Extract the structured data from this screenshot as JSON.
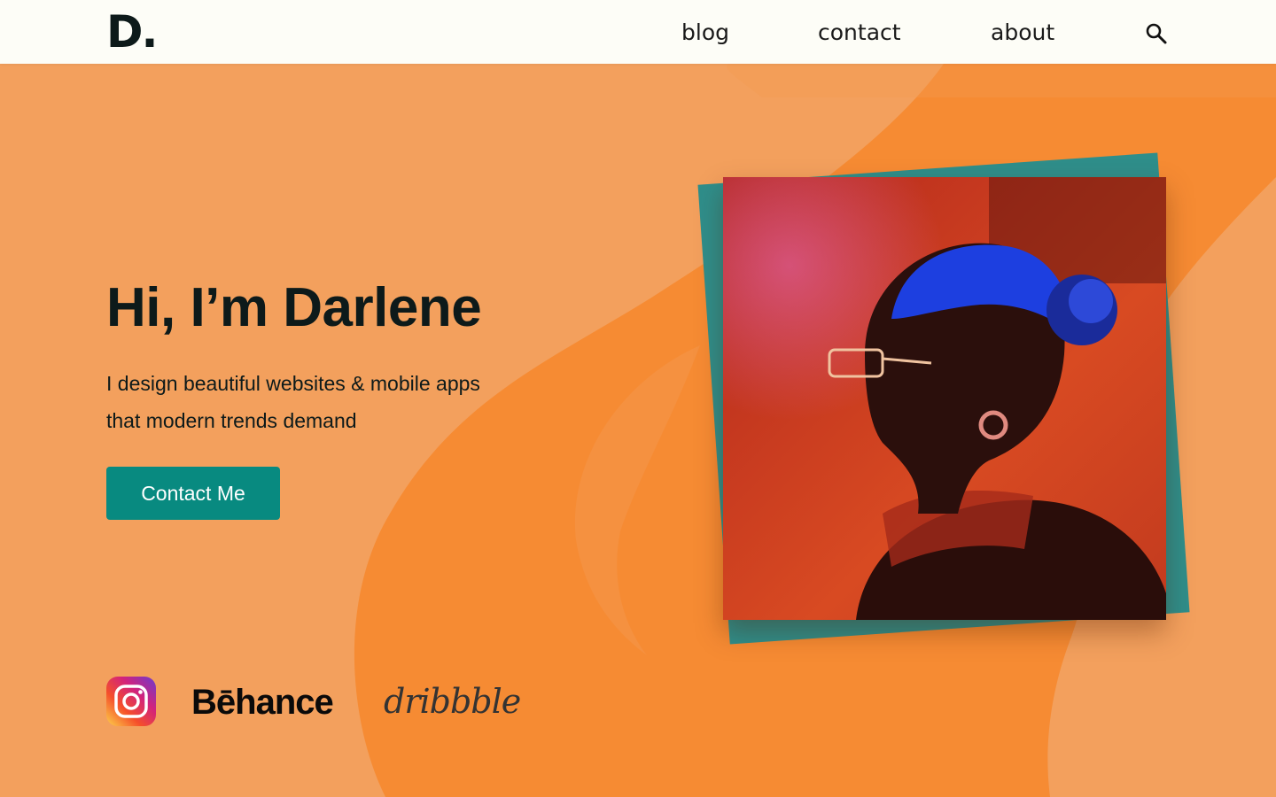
{
  "header": {
    "logo": "D.",
    "nav": {
      "blog": "blog",
      "contact": "contact",
      "about": "about"
    },
    "search_icon": "search-icon"
  },
  "hero": {
    "title": "Hi, I’m Darlene",
    "description": "I design beautiful websites & mobile apps that modern trends demand",
    "cta_label": "Contact Me"
  },
  "social": {
    "instagram_icon": "instagram-icon",
    "behance": "Bēhance",
    "dribbble": "dribbble"
  },
  "colors": {
    "background": "#f3a05d",
    "accent_orange": "#f68b33",
    "teal": "#088a80",
    "header_bg": "#fdfdf7",
    "text_dark": "#0d1a1a"
  }
}
